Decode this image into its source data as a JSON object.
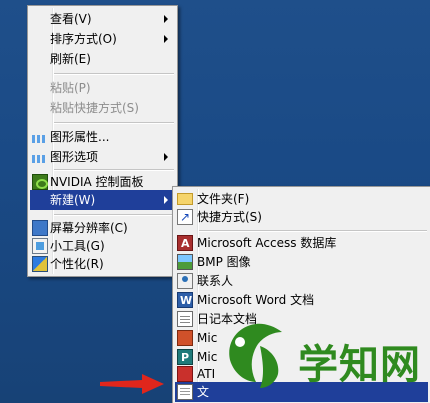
{
  "context_menu": {
    "items": [
      {
        "label": "查看(V)",
        "disabled": false,
        "submenu": true
      },
      {
        "label": "排序方式(O)",
        "disabled": false,
        "submenu": true
      },
      {
        "label": "刷新(E)",
        "disabled": false,
        "submenu": false
      },
      {
        "label": "粘贴(P)",
        "disabled": true,
        "submenu": false
      },
      {
        "label": "粘贴快捷方式(S)",
        "disabled": true,
        "submenu": false
      },
      {
        "label": "图形属性...",
        "icon": "graphics-icon",
        "submenu": false
      },
      {
        "label": "图形选项",
        "icon": "graphics-icon",
        "submenu": true
      },
      {
        "label": "NVIDIA 控制面板",
        "icon": "nvidia-icon",
        "submenu": false
      },
      {
        "label": "新建(W)",
        "highlighted": true,
        "submenu": true
      },
      {
        "label": "屏幕分辨率(C)",
        "icon": "monitor-icon",
        "submenu": false
      },
      {
        "label": "小工具(G)",
        "icon": "gadget-icon",
        "submenu": false
      },
      {
        "label": "个性化(R)",
        "icon": "personalize-icon",
        "submenu": false
      }
    ]
  },
  "new_submenu": {
    "items": [
      {
        "label": "文件夹(F)",
        "icon": "folder-icon"
      },
      {
        "label": "快捷方式(S)",
        "icon": "shortcut-icon"
      },
      {
        "label": "Microsoft Access 数据库",
        "icon": "access-icon"
      },
      {
        "label": "BMP 图像",
        "icon": "bmp-icon"
      },
      {
        "label": "联系人",
        "icon": "contact-icon"
      },
      {
        "label": "Microsoft Word 文档",
        "icon": "word-icon"
      },
      {
        "label": "日记本文档",
        "icon": "journal-icon"
      },
      {
        "label": "Mic",
        "icon": "powerpoint-icon"
      },
      {
        "label": "Mic",
        "icon": "publisher-icon"
      },
      {
        "label": "ATI",
        "icon": "ati-icon"
      },
      {
        "label": "文",
        "icon": "text-document-icon",
        "highlighted": true
      }
    ]
  },
  "watermark": {
    "text": "学知网"
  },
  "colors": {
    "highlight": "#1f3f9a",
    "desktop": "#1a4a86",
    "watermark": "#2f8a1f"
  }
}
